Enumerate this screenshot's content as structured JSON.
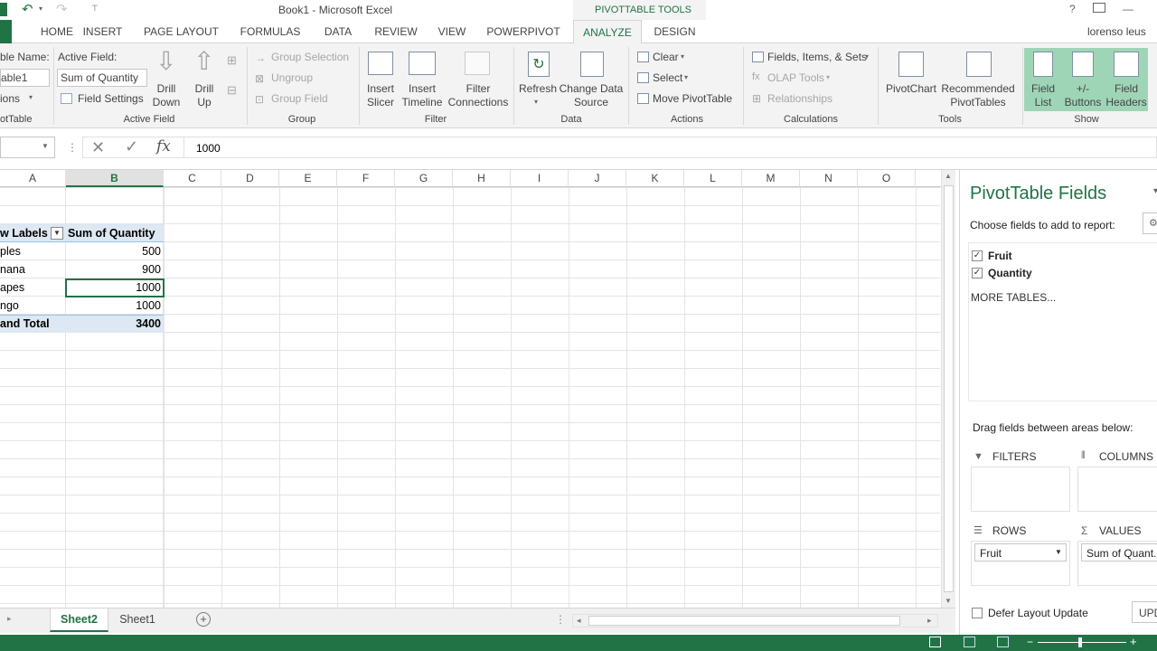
{
  "title": {
    "doc": "Book1 - Microsoft Excel",
    "context_tab": "PIVOTTABLE TOOLS",
    "user": "lorenso leus"
  },
  "tabs": [
    "HOME",
    "INSERT",
    "PAGE LAYOUT",
    "FORMULAS",
    "DATA",
    "REVIEW",
    "VIEW",
    "POWERPIVOT",
    "ANALYZE",
    "DESIGN"
  ],
  "ribbon": {
    "pivottable": {
      "name_label": "ble Name:",
      "name_value": "able1",
      "options": "ions",
      "group": "otTable"
    },
    "active_field": {
      "label": "Active Field:",
      "value": "Sum of Quantity",
      "settings": "Field Settings",
      "drill_down": "Drill\nDown",
      "drill_up": "Drill\nUp",
      "group": "Active Field"
    },
    "group": {
      "selection": "Group Selection",
      "ungroup": "Ungroup",
      "field": "Group Field",
      "group": "Group"
    },
    "filter": {
      "slicer": "Insert\nSlicer",
      "timeline": "Insert\nTimeline",
      "connections": "Filter\nConnections",
      "group": "Filter"
    },
    "data": {
      "refresh": "Refresh",
      "change_source": "Change Data\nSource",
      "group": "Data"
    },
    "actions": {
      "clear": "Clear",
      "select": "Select",
      "move": "Move PivotTable",
      "group": "Actions"
    },
    "calculations": {
      "fields": "Fields, Items, & Sets",
      "olap": "OLAP Tools",
      "relationships": "Relationships",
      "group": "Calculations"
    },
    "tools": {
      "pivotchart": "PivotChart",
      "recommended": "Recommended\nPivotTables",
      "group": "Tools"
    },
    "show": {
      "field_list": "Field\nList",
      "buttons": "+/-\nButtons",
      "headers": "Field\nHeaders",
      "group": "Show"
    }
  },
  "formula": {
    "value": "1000"
  },
  "columns": [
    "A",
    "B",
    "C",
    "D",
    "E",
    "F",
    "G",
    "H",
    "I",
    "J",
    "K",
    "L",
    "M",
    "N",
    "O"
  ],
  "pivot": {
    "header": [
      "w Labels",
      "Sum of Quantity"
    ],
    "rows": [
      [
        "ples",
        "500"
      ],
      [
        "nana",
        "900"
      ],
      [
        "apes",
        "1000"
      ],
      [
        "ngo",
        "1000"
      ]
    ],
    "total": [
      "and Total",
      "3400"
    ]
  },
  "sheets": {
    "active": "Sheet2",
    "other": "Sheet1"
  },
  "pane": {
    "title": "PivotTable Fields",
    "choose": "Choose fields to add to report:",
    "fields": [
      "Fruit",
      "Quantity"
    ],
    "more_tables": "MORE TABLES...",
    "drag": "Drag fields between areas below:",
    "filters": "FILTERS",
    "columns": "COLUMNS",
    "rows": "ROWS",
    "values": "VALUES",
    "rows_item": "Fruit",
    "values_item": "Sum of Quant...",
    "defer": "Defer Layout Update",
    "update": "UPD"
  },
  "colors": {
    "accent": "#217346",
    "highlight": "#dde8f3"
  }
}
